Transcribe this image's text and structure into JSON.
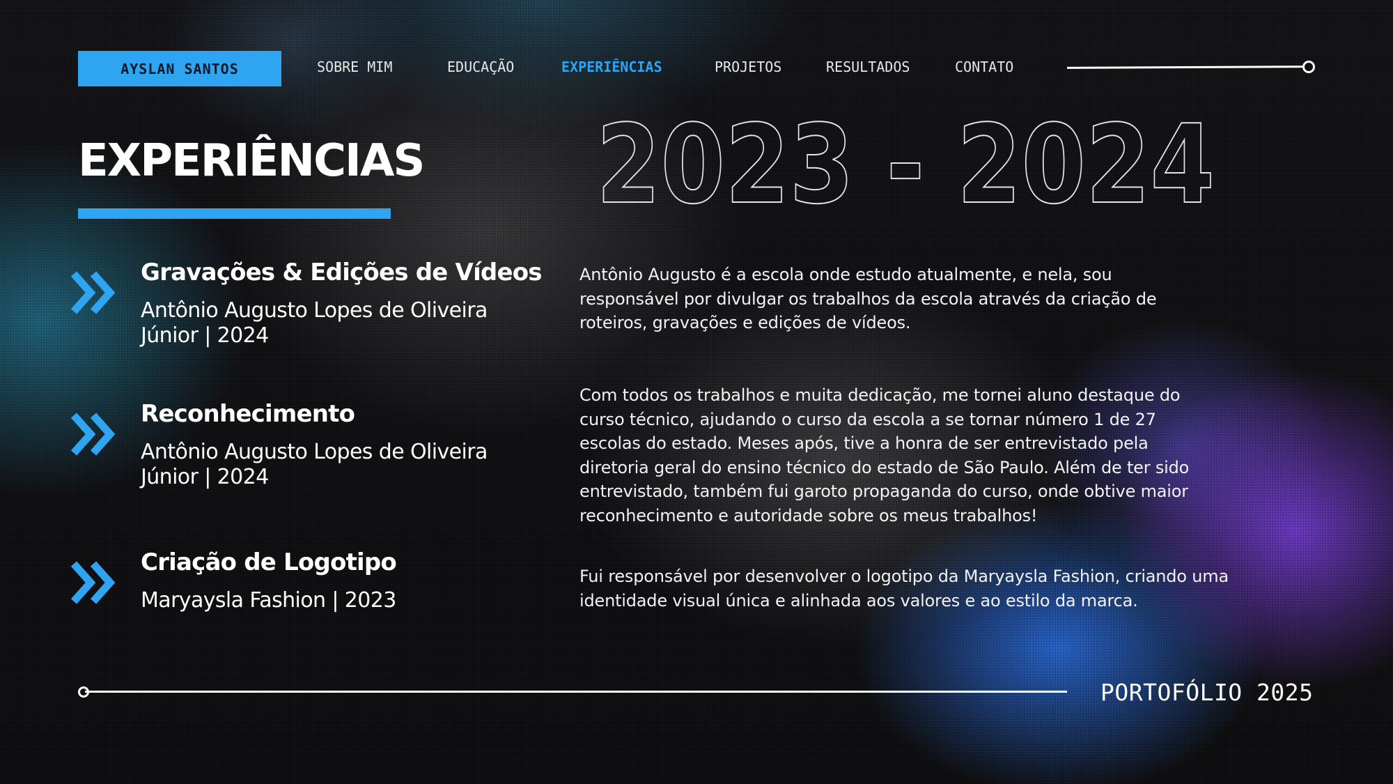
{
  "nav": {
    "brand": "AYSLAN SANTOS",
    "items": [
      {
        "label": "SOBRE MIM"
      },
      {
        "label": "EDUCAÇÃO"
      },
      {
        "label": "EXPERIÊNCIAS"
      },
      {
        "label": "PROJETOS"
      },
      {
        "label": "RESULTADOS"
      },
      {
        "label": "CONTATO"
      }
    ],
    "active_item": "EXPERIÊNCIAS"
  },
  "page_title": "EXPERIÊNCIAS",
  "year_range": "2023 - 2024",
  "experiences": [
    {
      "icon": "double-chevron-right-icon",
      "title": "Gravações & Edições de Vídeos",
      "subtitle": "Antônio Augusto Lopes de Oliveira Júnior | 2024",
      "description": "Antônio Augusto é a escola onde estudo atualmente, e nela, sou responsável por divulgar os trabalhos da escola através da criação de roteiros, gravações e edições de vídeos."
    },
    {
      "icon": "double-chevron-right-icon",
      "title": "Reconhecimento",
      "subtitle": "Antônio Augusto Lopes de Oliveira Júnior | 2024",
      "description": "Com todos os trabalhos e muita dedicação, me tornei aluno destaque do curso técnico, ajudando o curso da escola a se tornar número 1 de 27 escolas do estado. Meses após, tive a honra de ser entrevistado pela diretoria geral do ensino técnico do estado de São Paulo. Além de ter sido entrevistado, também fui garoto propaganda do curso, onde obtive maior reconhecimento e autoridade sobre os meus trabalhos!"
    },
    {
      "icon": "double-chevron-right-icon",
      "title": "Criação de Logotipo",
      "subtitle": "Maryaysla Fashion | 2023",
      "description": "Fui  responsável por  desenvolver o logotipo da Maryaysla Fashion, criando uma identidade visual única e alinhada aos valores e ao estilo da marca."
    }
  ],
  "footer": {
    "label": "PORTOFÓLIO 2025"
  },
  "colors": {
    "accent": "#2fa5f2",
    "background": "#0e0e10",
    "text": "#ffffff"
  }
}
